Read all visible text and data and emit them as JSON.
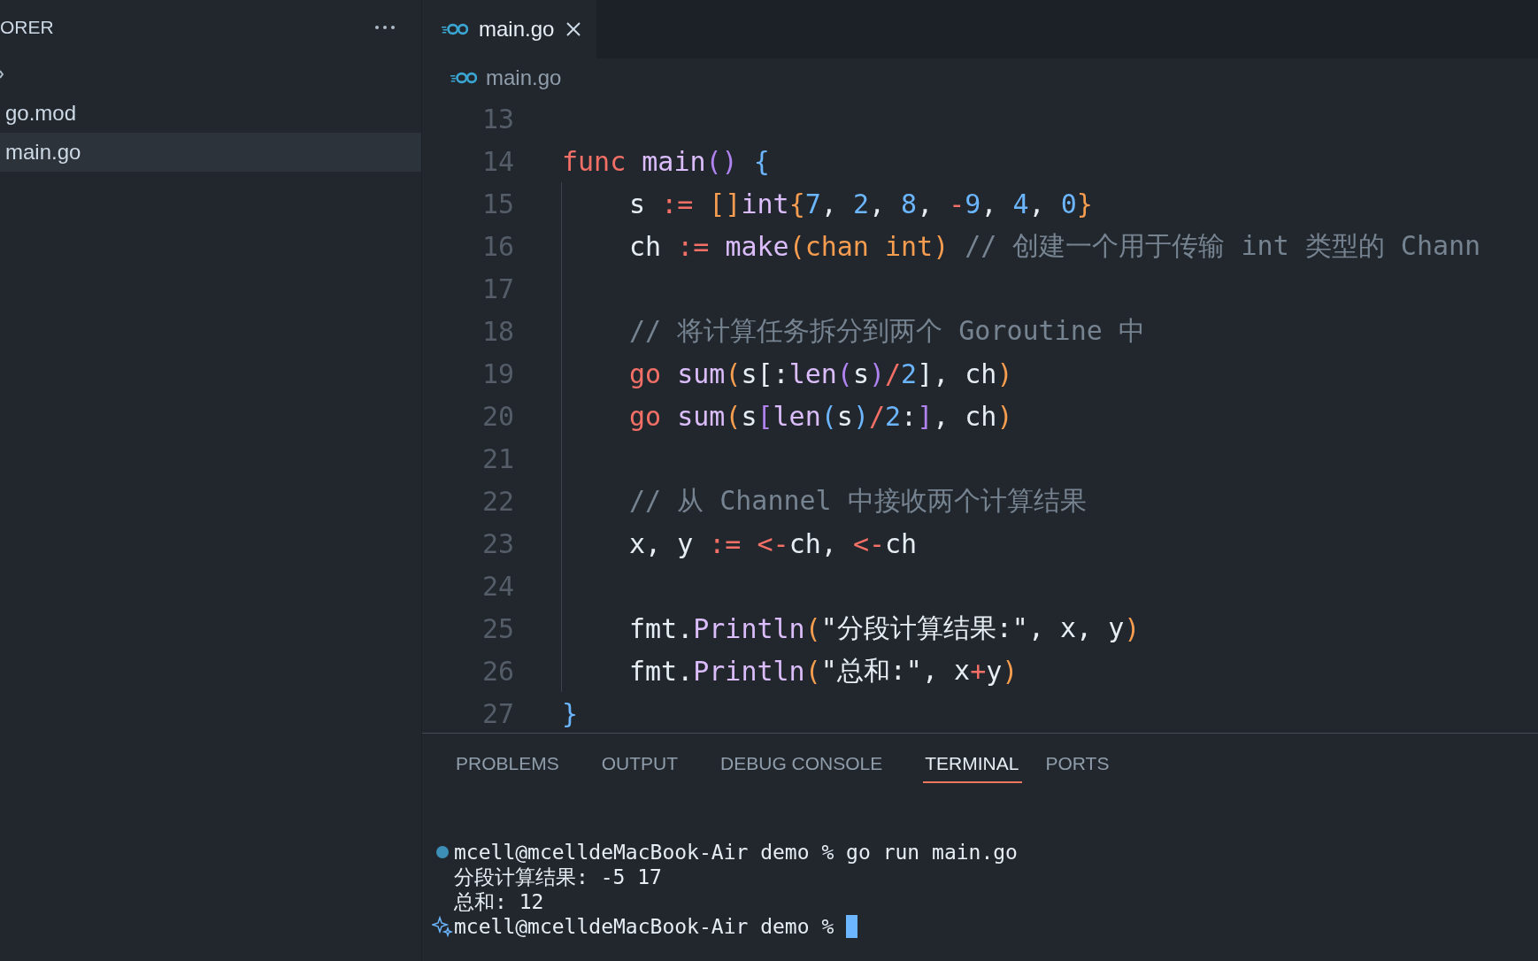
{
  "sidebar": {
    "title": "ORER",
    "items": [
      {
        "label": "go.mod",
        "selected": false
      },
      {
        "label": "main.go",
        "selected": true
      }
    ]
  },
  "tabs": [
    {
      "label": "main.go",
      "selected": true
    }
  ],
  "breadcrumb": "main.go",
  "editor": {
    "lines": [
      {
        "number": "13",
        "indented": false
      },
      {
        "number": "14",
        "indented": false,
        "tokens": [
          {
            "text": "func ",
            "kind": "keyword"
          },
          {
            "text": "main",
            "kind": "function"
          },
          {
            "text": "()",
            "kind": "bracket3"
          },
          {
            "text": " {",
            "kind": "bracket2"
          }
        ]
      },
      {
        "number": "15",
        "indented": true,
        "tokens": [
          {
            "text": "s ",
            "kind": "plain"
          },
          {
            "text": ":= ",
            "kind": "keyword"
          },
          {
            "text": "[]",
            "kind": "bracket1"
          },
          {
            "text": "int",
            "kind": "function"
          },
          {
            "text": "{",
            "kind": "bracket1"
          },
          {
            "text": "7",
            "kind": "number"
          },
          {
            "text": ", ",
            "kind": "plain"
          },
          {
            "text": "2",
            "kind": "number"
          },
          {
            "text": ", ",
            "kind": "plain"
          },
          {
            "text": "8",
            "kind": "number"
          },
          {
            "text": ", ",
            "kind": "plain"
          },
          {
            "text": "-",
            "kind": "keyword"
          },
          {
            "text": "9",
            "kind": "number"
          },
          {
            "text": ", ",
            "kind": "plain"
          },
          {
            "text": "4",
            "kind": "number"
          },
          {
            "text": ", ",
            "kind": "plain"
          },
          {
            "text": "0",
            "kind": "number"
          },
          {
            "text": "}",
            "kind": "bracket1"
          }
        ]
      },
      {
        "number": "16",
        "indented": true,
        "tokens": [
          {
            "text": "ch ",
            "kind": "plain"
          },
          {
            "text": ":= ",
            "kind": "keyword"
          },
          {
            "text": "make",
            "kind": "function"
          },
          {
            "text": "(",
            "kind": "bracket1"
          },
          {
            "text": "chan int",
            "kind": "type"
          },
          {
            "text": ")",
            "kind": "bracket1"
          },
          {
            "text": " // 创建一个用于传输 int 类型的 Chann",
            "kind": "comment"
          }
        ]
      },
      {
        "number": "17",
        "indented": true
      },
      {
        "number": "18",
        "indented": true,
        "tokens": [
          {
            "text": "// 将计算任务拆分到两个 Goroutine 中",
            "kind": "comment"
          }
        ]
      },
      {
        "number": "19",
        "indented": true,
        "tokens": [
          {
            "text": "go ",
            "kind": "keyword"
          },
          {
            "text": "sum",
            "kind": "function"
          },
          {
            "text": "(",
            "kind": "bracket1"
          },
          {
            "text": "s[:",
            "kind": "plain"
          },
          {
            "text": "len",
            "kind": "function"
          },
          {
            "text": "(",
            "kind": "bracket3"
          },
          {
            "text": "s",
            "kind": "plain"
          },
          {
            "text": ")",
            "kind": "bracket3"
          },
          {
            "text": "/",
            "kind": "keyword"
          },
          {
            "text": "2",
            "kind": "number"
          },
          {
            "text": "], ch",
            "kind": "plain"
          },
          {
            "text": ")",
            "kind": "bracket1"
          }
        ]
      },
      {
        "number": "20",
        "indented": true,
        "tokens": [
          {
            "text": "go ",
            "kind": "keyword"
          },
          {
            "text": "sum",
            "kind": "function"
          },
          {
            "text": "(",
            "kind": "bracket1"
          },
          {
            "text": "s",
            "kind": "plain"
          },
          {
            "text": "[",
            "kind": "bracket3"
          },
          {
            "text": "len",
            "kind": "function"
          },
          {
            "text": "(",
            "kind": "bracket2"
          },
          {
            "text": "s",
            "kind": "plain"
          },
          {
            "text": ")",
            "kind": "bracket2"
          },
          {
            "text": "/",
            "kind": "keyword"
          },
          {
            "text": "2",
            "kind": "number"
          },
          {
            "text": ":",
            "kind": "plain"
          },
          {
            "text": "]",
            "kind": "bracket3"
          },
          {
            "text": ", ch",
            "kind": "plain"
          },
          {
            "text": ")",
            "kind": "bracket1"
          }
        ]
      },
      {
        "number": "21",
        "indented": true
      },
      {
        "number": "22",
        "indented": true,
        "tokens": [
          {
            "text": "// 从 Channel 中接收两个计算结果",
            "kind": "comment"
          }
        ]
      },
      {
        "number": "23",
        "indented": true,
        "tokens": [
          {
            "text": "x, y ",
            "kind": "plain"
          },
          {
            "text": ":= ",
            "kind": "keyword"
          },
          {
            "text": "<-",
            "kind": "keyword"
          },
          {
            "text": "ch, ",
            "kind": "plain"
          },
          {
            "text": "<-",
            "kind": "keyword"
          },
          {
            "text": "ch",
            "kind": "plain"
          }
        ]
      },
      {
        "number": "24",
        "indented": true
      },
      {
        "number": "25",
        "indented": true,
        "tokens": [
          {
            "text": "fmt.",
            "kind": "plain"
          },
          {
            "text": "Println",
            "kind": "function"
          },
          {
            "text": "(",
            "kind": "bracket1"
          },
          {
            "text": "\"分段计算结果:\", x, y",
            "kind": "plain"
          },
          {
            "text": ")",
            "kind": "bracket1"
          }
        ]
      },
      {
        "number": "26",
        "indented": true,
        "tokens": [
          {
            "text": "fmt.",
            "kind": "plain"
          },
          {
            "text": "Println",
            "kind": "function"
          },
          {
            "text": "(",
            "kind": "bracket1"
          },
          {
            "text": "\"总和:\", x",
            "kind": "plain"
          },
          {
            "text": "+",
            "kind": "keyword"
          },
          {
            "text": "y",
            "kind": "plain"
          },
          {
            "text": ")",
            "kind": "bracket1"
          }
        ]
      },
      {
        "number": "27",
        "indented": false,
        "tokens": [
          {
            "text": "}",
            "kind": "bracket2"
          }
        ]
      }
    ]
  },
  "panel_tabs": [
    {
      "label": "PROBLEMS",
      "selected": false
    },
    {
      "label": "OUTPUT",
      "selected": false
    },
    {
      "label": "DEBUG CONSOLE",
      "selected": false
    },
    {
      "label": "TERMINAL",
      "selected": true
    },
    {
      "label": "PORTS",
      "selected": false
    }
  ],
  "terminal": [
    {
      "kind": "command",
      "text": "mcell@mcelldeMacBook-Air demo % go run main.go"
    },
    {
      "kind": "output",
      "text": "分段计算结果: -5 17"
    },
    {
      "kind": "output",
      "text": "总和: 12"
    },
    {
      "kind": "prompt",
      "text": "mcell@mcelldeMacBook-Air demo %"
    }
  ]
}
